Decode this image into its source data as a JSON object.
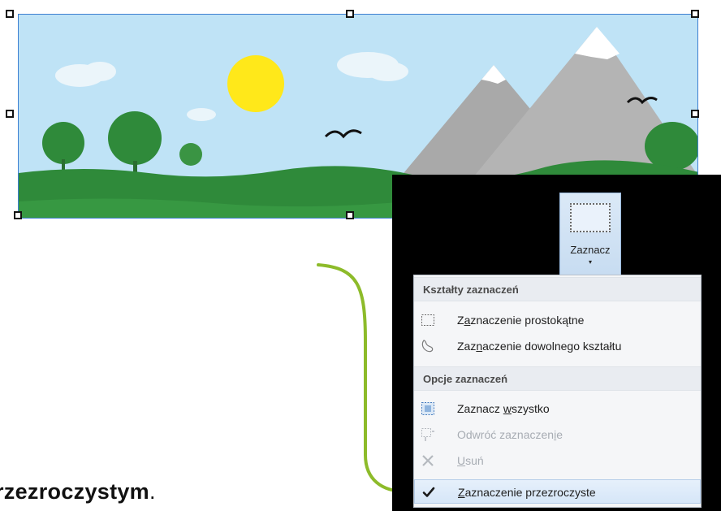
{
  "canvas": {
    "colors": {
      "sky": "#bfe3f6",
      "grass": "#2f8a3a",
      "sun": "#ffe81a",
      "mountain": "#a8a8a8",
      "snow": "#ffffff",
      "selection_border": "#3c7fd1"
    },
    "scene": [
      "sun",
      "clouds",
      "trees",
      "mountains",
      "birds",
      "grass"
    ]
  },
  "select_button": {
    "label": "Zaznacz",
    "icon": "rectangular-selection-icon",
    "caret": "▾"
  },
  "menu": {
    "header_shapes": "Kształty zaznaczeń",
    "header_options": "Opcje zaznaczeń",
    "items": [
      {
        "pre": "Z",
        "acc": "a",
        "post": "znaczenie prostokątne",
        "icon": "rectangle-select-icon",
        "enabled": true,
        "checked": false
      },
      {
        "pre": "Zaz",
        "acc": "n",
        "post": "aczenie dowolnego kształtu",
        "icon": "free-form-select-icon",
        "enabled": true,
        "checked": false
      },
      {
        "pre": "Zaznacz ",
        "acc": "w",
        "post": "szystko",
        "icon": "select-all-icon",
        "enabled": true,
        "checked": false
      },
      {
        "pre": "Odwróć zaznaczen",
        "acc": "i",
        "post": "e",
        "icon": "invert-selection-icon",
        "enabled": false,
        "checked": false
      },
      {
        "pre": "",
        "acc": "U",
        "post": "suń",
        "icon": "delete-icon",
        "enabled": false,
        "checked": false
      },
      {
        "pre": "",
        "acc": "Z",
        "post": "aznaczenie przezroczyste",
        "icon": "checkmark-icon",
        "enabled": true,
        "checked": true
      }
    ]
  },
  "caption": {
    "text": "rzezroczystym",
    "dot": "."
  },
  "arrow": {
    "color": "#8dbb2a"
  }
}
